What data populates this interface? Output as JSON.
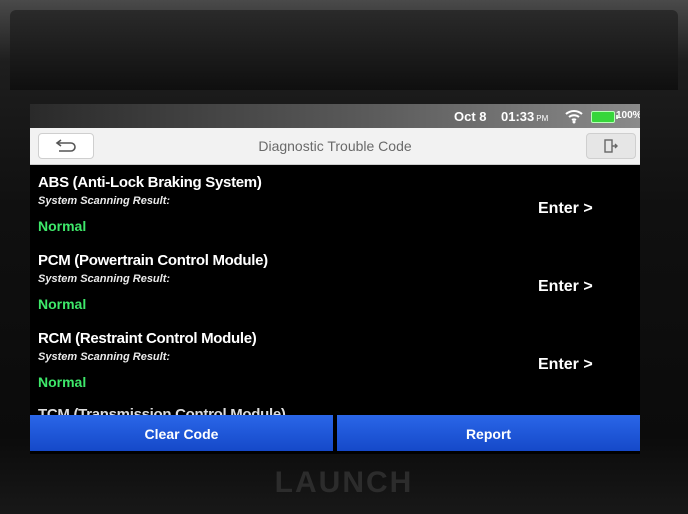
{
  "status_bar": {
    "date": "Oct 8",
    "time": "01:33",
    "ampm": "PM",
    "battery": "100%",
    "wifi_icon": "wifi-icon",
    "battery_icon": "battery-icon",
    "battery_color": "#36d63a"
  },
  "title_bar": {
    "title": "Diagnostic Trouble Code",
    "back_icon": "back-arrow-icon",
    "exit_icon": "exit-icon"
  },
  "modules": [
    {
      "name": "ABS (Anti-Lock Braking System)",
      "result_label": "System Scanning Result:",
      "status": "Normal",
      "action": "Enter >"
    },
    {
      "name": "PCM (Powertrain Control Module)",
      "result_label": "System Scanning Result:",
      "status": "Normal",
      "action": "Enter >"
    },
    {
      "name": "RCM (Restraint Control Module)",
      "result_label": "System Scanning Result:",
      "status": "Normal",
      "action": "Enter >"
    },
    {
      "name": "TCM (Transmission Control Module)"
    }
  ],
  "bottom_buttons": {
    "clear": "Clear Code",
    "report": "Report",
    "color": "#1f5ad9"
  },
  "status_color": "#3ee86a",
  "brand": "LAUNCH"
}
